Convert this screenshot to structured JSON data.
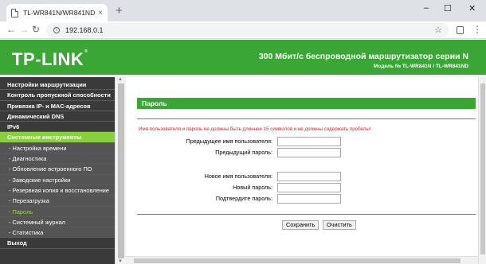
{
  "browser": {
    "tab_title": "TL-WR841N/WR841ND",
    "tab_close": "×",
    "new_tab": "+",
    "url": "192.168.0.1",
    "win_min": "–",
    "win_max": "☐",
    "win_close": "✕",
    "back": "←",
    "forward": "→",
    "reload": "↻",
    "star": "☆",
    "menu": "⋮"
  },
  "header": {
    "logo": "TP-LINK",
    "logo_mark": "®",
    "title": "300 Мбит/с беспроводной маршрутизатор серии N",
    "model": "Модель № TL-WR841N / TL-WR841ND"
  },
  "sidebar": {
    "items": [
      {
        "label": "Настройки маршрутизации",
        "type": "top"
      },
      {
        "label": "Контроль пропускной способности",
        "type": "top"
      },
      {
        "label": "Привязка IP- и MAC-адресов",
        "type": "top"
      },
      {
        "label": "Динамический DNS",
        "type": "top"
      },
      {
        "label": "IPv6",
        "type": "top"
      },
      {
        "label": "Системные инструменты",
        "type": "active"
      },
      {
        "label": "- Настройка времени",
        "type": "sub"
      },
      {
        "label": "- Диагностика",
        "type": "sub"
      },
      {
        "label": "- Обновление встроенного ПО",
        "type": "sub"
      },
      {
        "label": "- Заводские настройки",
        "type": "sub"
      },
      {
        "label": "- Резервная копия и восстановление",
        "type": "sub"
      },
      {
        "label": "- Перезагрузка",
        "type": "sub"
      },
      {
        "label": "- Пароль",
        "type": "current"
      },
      {
        "label": "- Системный журнал",
        "type": "sub"
      },
      {
        "label": "- Статистика",
        "type": "sub"
      },
      {
        "label": "Выход",
        "type": "top"
      }
    ]
  },
  "main": {
    "panel_title": "Пароль",
    "warning": "Имя пользователя и пароль не должны быть длиннее 15 символов и не должны содержать пробелы!",
    "fields": {
      "old_user": {
        "label": "Предыдущее имя пользователя:",
        "value": ""
      },
      "old_pass": {
        "label": "Предыдущий пароль:",
        "value": ""
      },
      "new_user": {
        "label": "Новое имя пользователя:",
        "value": ""
      },
      "new_pass": {
        "label": "Новый пароль:",
        "value": ""
      },
      "confirm_pass": {
        "label": "Подтвердите пароль:",
        "value": ""
      }
    },
    "save_label": "Сохранить",
    "clear_label": "Очистить"
  },
  "colors": {
    "brand_green": "#3aa635",
    "menu_active": "#8ad03c",
    "menu_current_text": "#9ad743",
    "warning_red": "#e02020"
  }
}
